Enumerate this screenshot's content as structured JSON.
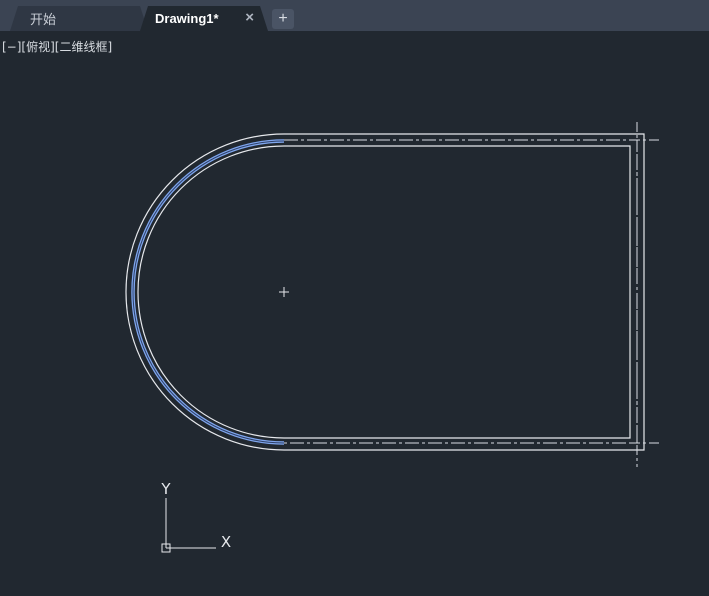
{
  "tabs": [
    {
      "label": "开始",
      "active": false
    },
    {
      "label": "Drawing1*",
      "active": true,
      "close_icon": "close-icon"
    }
  ],
  "add_tab_label": "+",
  "viewport_controls": {
    "minimize": "[−]",
    "view": "[俯视]",
    "visual_style": "[二维线框]"
  },
  "ucs_icon": {
    "x_label": "X",
    "y_label": "Y"
  },
  "colors": {
    "background": "#212830",
    "tabbar": "#3b4453",
    "line": "#e6e8ec",
    "selected": "#7fa6ee"
  }
}
